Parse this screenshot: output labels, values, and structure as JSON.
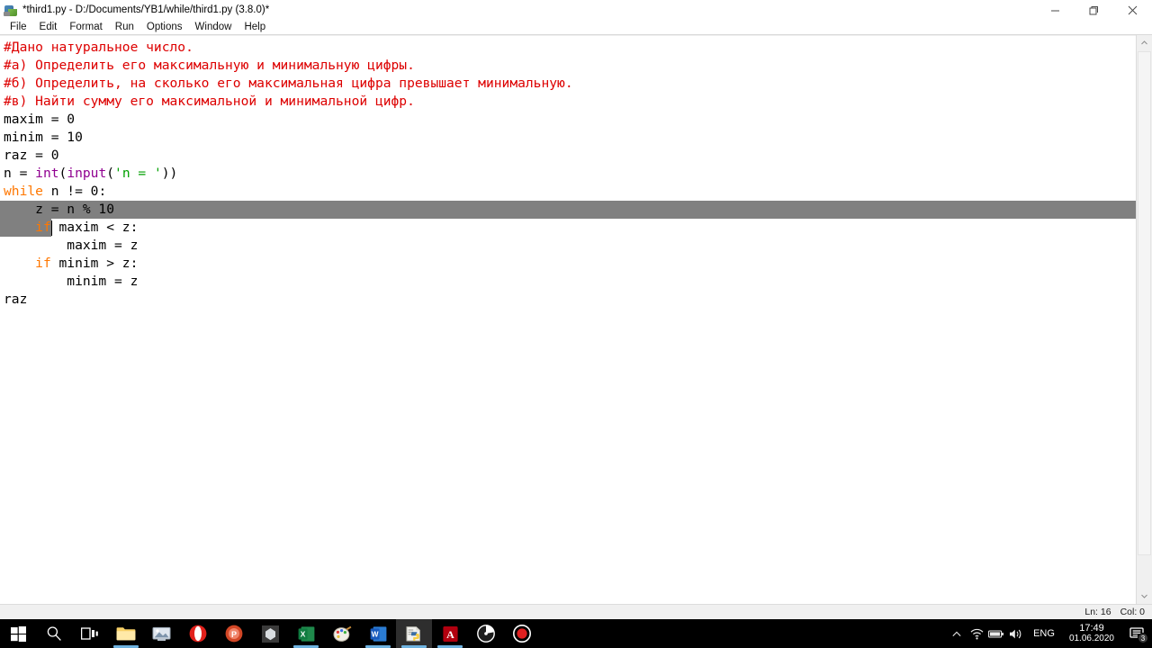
{
  "window": {
    "title": "*third1.py - D:/Documents/YB1/while/third1.py (3.8.0)*",
    "icon": "python-idle-icon",
    "controls": {
      "minimize": "minimize-icon",
      "restore": "restore-icon",
      "close": "close-icon"
    }
  },
  "menubar": {
    "items": [
      {
        "label": "File"
      },
      {
        "label": "Edit"
      },
      {
        "label": "Format"
      },
      {
        "label": "Run"
      },
      {
        "label": "Options"
      },
      {
        "label": "Window"
      },
      {
        "label": "Help"
      }
    ]
  },
  "editor": {
    "lines": [
      {
        "n": 1,
        "indent": 0,
        "selection": "none",
        "tokens": [
          {
            "t": "#Дано натуральное число.",
            "c": "cmt"
          }
        ]
      },
      {
        "n": 2,
        "indent": 0,
        "selection": "none",
        "tokens": [
          {
            "t": "#а) Определить его максимальную и минимальную цифры.",
            "c": "cmt"
          }
        ]
      },
      {
        "n": 3,
        "indent": 0,
        "selection": "none",
        "tokens": [
          {
            "t": "#б) Определить, на сколько его максимальная цифра превышает минимальную.",
            "c": "cmt"
          }
        ]
      },
      {
        "n": 4,
        "indent": 0,
        "selection": "none",
        "tokens": [
          {
            "t": "#в) Найти сумму его максимальной и минимальной цифр.",
            "c": "cmt"
          }
        ]
      },
      {
        "n": 5,
        "indent": 0,
        "selection": "none",
        "tokens": [
          {
            "t": "maxim = 0",
            "c": "plain"
          }
        ]
      },
      {
        "n": 6,
        "indent": 0,
        "selection": "none",
        "tokens": [
          {
            "t": "minim = 10",
            "c": "plain"
          }
        ]
      },
      {
        "n": 7,
        "indent": 0,
        "selection": "none",
        "tokens": [
          {
            "t": "raz = 0",
            "c": "plain"
          }
        ]
      },
      {
        "n": 8,
        "indent": 0,
        "selection": "none",
        "tokens": [
          {
            "t": "n = ",
            "c": "plain"
          },
          {
            "t": "int",
            "c": "bi"
          },
          {
            "t": "(",
            "c": "plain"
          },
          {
            "t": "input",
            "c": "bi"
          },
          {
            "t": "(",
            "c": "plain"
          },
          {
            "t": "'n = '",
            "c": "str"
          },
          {
            "t": "))",
            "c": "plain"
          }
        ]
      },
      {
        "n": 9,
        "indent": 0,
        "selection": "none",
        "tokens": [
          {
            "t": "while",
            "c": "kw"
          },
          {
            "t": " n != 0:",
            "c": "plain"
          }
        ]
      },
      {
        "n": 10,
        "indent": 0,
        "selection": "full",
        "tokens": [
          {
            "t": "    z = n % 10",
            "c": "plain"
          }
        ]
      },
      {
        "n": 11,
        "indent": 0,
        "selection": "partial",
        "tokens": [
          {
            "t": "    ",
            "c": "plain"
          },
          {
            "t": "if",
            "c": "kw"
          },
          {
            "t": " maxim < z:",
            "c": "plain"
          }
        ]
      },
      {
        "n": 12,
        "indent": 0,
        "selection": "none",
        "tokens": [
          {
            "t": "        maxim = z",
            "c": "plain"
          }
        ]
      },
      {
        "n": 13,
        "indent": 0,
        "selection": "none",
        "tokens": [
          {
            "t": "    ",
            "c": "plain"
          },
          {
            "t": "if",
            "c": "kw"
          },
          {
            "t": " minim > z:",
            "c": "plain"
          }
        ]
      },
      {
        "n": 14,
        "indent": 0,
        "selection": "none",
        "tokens": [
          {
            "t": "        minim = z",
            "c": "plain"
          }
        ]
      },
      {
        "n": 15,
        "indent": 0,
        "selection": "none",
        "tokens": [
          {
            "t": "raz",
            "c": "plain"
          }
        ]
      }
    ],
    "colors": {
      "comment": "#dd0000",
      "keyword": "#ff7700",
      "builtin": "#900090",
      "string": "#00a000",
      "plain": "#000000",
      "selection": "#808080",
      "background": "#ffffff"
    }
  },
  "scrollbar": {
    "up_arrow": "chevron-up-icon",
    "down_arrow": "chevron-down-icon"
  },
  "statusbar": {
    "line_label": "Ln: 16",
    "col_label": "Col: 0"
  },
  "taskbar": {
    "items": [
      {
        "name": "start-button",
        "icon": "windows-logo-icon",
        "active": false,
        "running": false
      },
      {
        "name": "search-button",
        "icon": "search-icon",
        "active": false,
        "running": false
      },
      {
        "name": "task-view-button",
        "icon": "task-view-icon",
        "active": false,
        "running": false
      },
      {
        "name": "file-explorer",
        "icon": "folder-icon",
        "active": false,
        "running": true
      },
      {
        "name": "photos-app",
        "icon": "photos-icon",
        "active": false,
        "running": false
      },
      {
        "name": "opera-browser",
        "icon": "opera-icon",
        "active": false,
        "running": false
      },
      {
        "name": "powerpoint",
        "icon": "powerpoint-icon",
        "active": false,
        "running": false
      },
      {
        "name": "unity-app",
        "icon": "unity-icon",
        "active": false,
        "running": false
      },
      {
        "name": "excel",
        "icon": "excel-icon",
        "active": false,
        "running": true
      },
      {
        "name": "paint",
        "icon": "paint-icon",
        "active": false,
        "running": false
      },
      {
        "name": "word",
        "icon": "word-icon",
        "active": false,
        "running": true
      },
      {
        "name": "python-idle",
        "icon": "python-idle-icon",
        "active": true,
        "running": true
      },
      {
        "name": "adobe-acrobat",
        "icon": "acrobat-icon",
        "active": false,
        "running": true
      },
      {
        "name": "speedometer-app",
        "icon": "speedometer-icon",
        "active": false,
        "running": false
      },
      {
        "name": "screen-recorder",
        "icon": "record-icon",
        "active": false,
        "running": false
      }
    ],
    "tray": {
      "overflow": "chevron-up-icon",
      "wifi": "wifi-icon",
      "battery": "battery-icon",
      "volume": "volume-icon",
      "language": "ENG",
      "time": "17:49",
      "date": "01.06.2020",
      "notifications_icon": "notification-icon",
      "notifications_count": "3"
    }
  }
}
